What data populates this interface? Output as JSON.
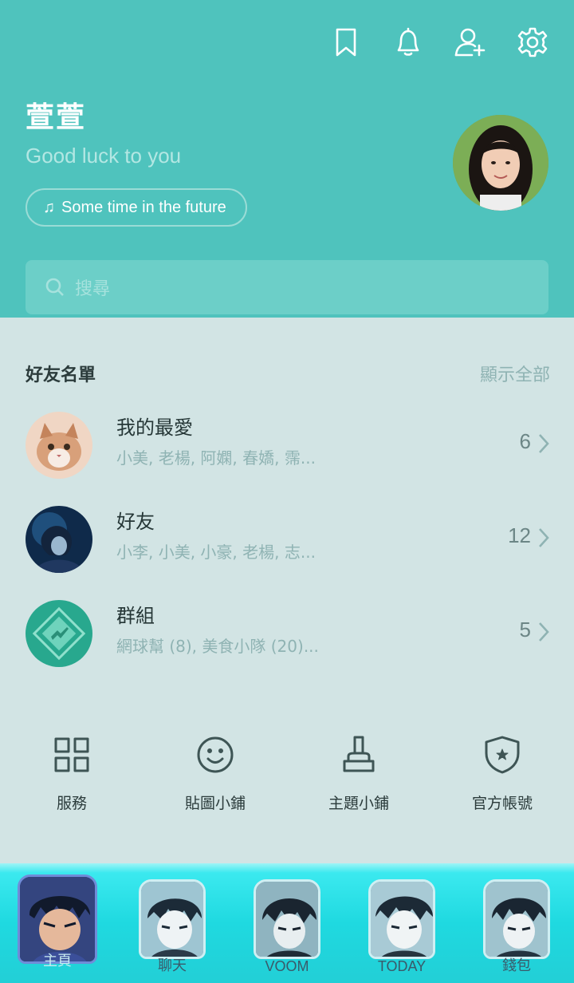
{
  "header": {
    "icons": [
      "bookmark-icon",
      "bell-icon",
      "add-friend-icon",
      "gear-icon"
    ],
    "profile_name": "萱萱",
    "status_message": "Good luck to you",
    "music_note_icon": "music-note-icon",
    "music_label": "Some time in the future",
    "search_placeholder": "搜尋"
  },
  "friends": {
    "title": "好友名單",
    "show_all": "顯示全部",
    "rows": [
      {
        "title": "我的最愛",
        "subtitle": "小美, 老楊, 阿嫻, 春嬌, 霈...",
        "count": "6"
      },
      {
        "title": "好友",
        "subtitle": "小李, 小美, 小豪, 老楊, 志...",
        "count": "12"
      },
      {
        "title": "群組",
        "subtitle": "網球幫 (8), 美食小隊 (20)...",
        "count": "5"
      }
    ]
  },
  "services": [
    {
      "label": "服務",
      "icon": "grid-icon"
    },
    {
      "label": "貼圖小鋪",
      "icon": "smiley-icon"
    },
    {
      "label": "主題小鋪",
      "icon": "brush-icon"
    },
    {
      "label": "官方帳號",
      "icon": "shield-star-icon"
    }
  ],
  "bottom_tabs": [
    {
      "label": "主頁",
      "active": true
    },
    {
      "label": "聊天",
      "active": false
    },
    {
      "label": "VOOM",
      "active": false
    },
    {
      "label": "TODAY",
      "active": false
    },
    {
      "label": "錢包",
      "active": false
    }
  ],
  "colors": {
    "header_bg": "#4fc3bd",
    "body_bg": "#d2e4e4",
    "tab_bar": "#1fd9e0",
    "text_dark": "#253636",
    "text_muted": "#8fb3b3"
  }
}
